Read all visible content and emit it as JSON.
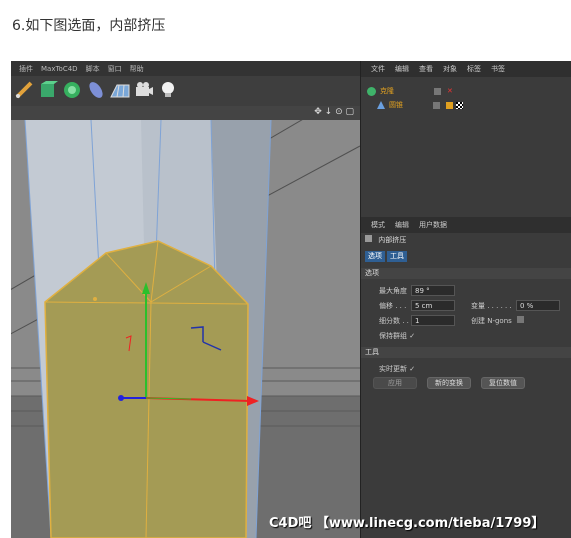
{
  "caption": "6.如下图选面，内部挤压",
  "menu": [
    "插件",
    "MaxToC4D",
    "脚本",
    "窗口",
    "帮助"
  ],
  "toolbar_icons": [
    "pen-tool-icon",
    "cube-icon",
    "deformer-icon",
    "capsule-icon",
    "floor-grid-icon",
    "camera-icon",
    "light-bulb-icon"
  ],
  "viewport_icons": "✥ ↓ ⊙ ▢",
  "object_manager": {
    "menu": [
      "文件",
      "编辑",
      "查看",
      "对象",
      "标签",
      "书签"
    ],
    "objects": [
      {
        "name": "克隆",
        "icon": "cloner-icon"
      },
      {
        "name": "圆锥",
        "icon": "cone-icon"
      }
    ]
  },
  "attributes": {
    "menu": [
      "模式",
      "编辑",
      "用户数据"
    ],
    "tool_title": "内部挤压",
    "tabs": [
      "选项",
      "工具"
    ],
    "options_section": "选项",
    "max_angle_label": "最大角度",
    "max_angle_value": "89 °",
    "offset_label": "偏移 . . .",
    "offset_value": "5 cm",
    "variance_label": "变量 . . . . . .",
    "variance_value": "0 %",
    "subdiv_label": "细分数 . .",
    "subdiv_value": "1",
    "ngons_label": "创建 N-gons",
    "keep_groups_label": "保持群组 ✓",
    "tool_section": "工具",
    "realtime_label": "实时更新 ✓",
    "apply_button": "应用",
    "new_transform_button": "新的变换",
    "reset_button": "复位数值"
  },
  "watermark": "C4D吧 【www.linecg.com/tieba/1799】"
}
